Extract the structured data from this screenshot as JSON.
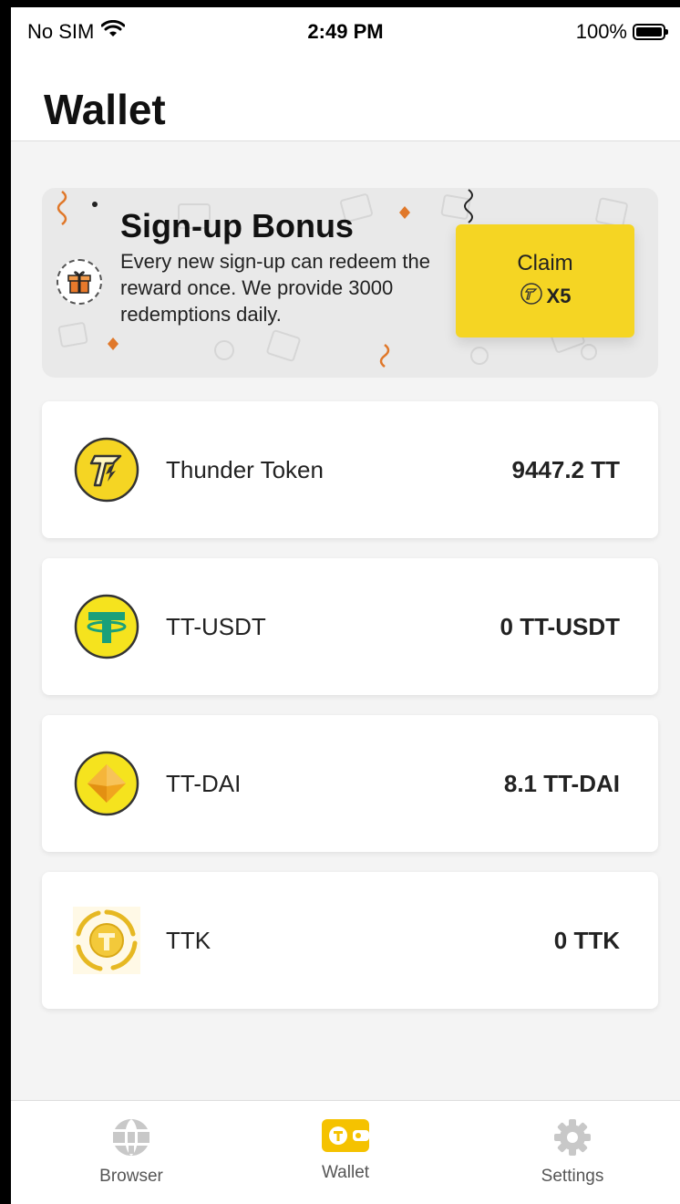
{
  "status_bar": {
    "carrier": "No SIM",
    "time": "2:49 PM",
    "battery": "100%",
    "icons": [
      "wifi-icon",
      "battery-icon"
    ]
  },
  "header": {
    "title": "Wallet"
  },
  "banner": {
    "title": "Sign-up Bonus",
    "description": "Every new sign-up can redeem the reward once. We provide 3000 redemptions daily.",
    "claim_label": "Claim",
    "claim_multiplier": "X5",
    "icons": [
      "gift-icon",
      "thunder-token-icon"
    ]
  },
  "tokens": [
    {
      "name": "Thunder Token",
      "balance": "9447.2 TT",
      "icon": "thunder-token-icon"
    },
    {
      "name": "TT-USDT",
      "balance": "0 TT-USDT",
      "icon": "tether-icon"
    },
    {
      "name": "TT-DAI",
      "balance": "8.1 TT-DAI",
      "icon": "dai-icon"
    },
    {
      "name": "TTK",
      "balance": "0 TTK",
      "icon": "ttk-icon"
    }
  ],
  "tab_bar": {
    "tabs": [
      {
        "label": "Browser",
        "icon": "globe-icon",
        "active": false
      },
      {
        "label": "Wallet",
        "icon": "wallet-icon",
        "active": true
      },
      {
        "label": "Settings",
        "icon": "gear-icon",
        "active": false
      }
    ]
  },
  "colors": {
    "accent": "#f5d523",
    "inactive_icon": "#c8c8c8",
    "text": "#222222"
  }
}
